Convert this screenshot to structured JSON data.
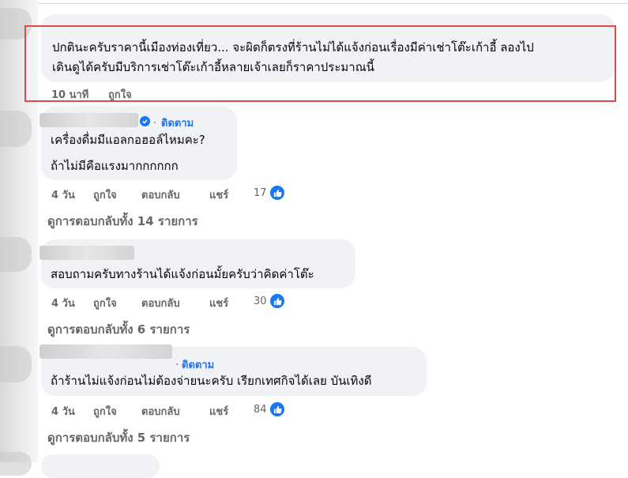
{
  "comment_highlighted": {
    "line1": "ปกตินะครับราคานี้เมืองท่องเที่ยว... จะผิดก็ตรงที่ร้านไม่ได้แจ้งก่อนเรื่องมีค่าเช่าโต๊ะเก้าอี้ ลองไป",
    "line2": "เดินดูได้ครับมีบริการเช่าโต๊ะเก้าอี้หลายเจ้าเลยก็ราคาประมาณนี้",
    "time": "10 นาที",
    "like": "ถูกใจ"
  },
  "comment1": {
    "dot": "·",
    "follow": "ติดตาม",
    "line1": "เครื่องดื่มมีแอลกอฮอล์ไหมคะ?",
    "line2": "ถ้าไม่มีคือแรงมากกกกกก",
    "time": "4 วัน",
    "like": "ถูกใจ",
    "reply": "ตอบกลับ",
    "share": "แชร์",
    "likes": "17",
    "view_replies": "ดูการตอบกลับทั้ง 14 รายการ"
  },
  "comment2": {
    "line1": "สอบถามครับทางร้านได้แจ้งก่อนมั้ยครับว่าคิดค่าโต๊ะ",
    "time": "4 วัน",
    "like": "ถูกใจ",
    "reply": "ตอบกลับ",
    "share": "แชร์",
    "likes": "30",
    "view_replies": "ดูการตอบกลับทั้ง 6 รายการ"
  },
  "comment3": {
    "dot": "·",
    "follow": "ติดตาม",
    "line1": "ถ้าร้านไม่แจ้งก่อนไม่ต้องจ่ายนะครับ เรียกเทศกิจได้เลย บันเทิงดี",
    "time": "4 วัน",
    "like": "ถูกใจ",
    "reply": "ตอบกลับ",
    "share": "แชร์",
    "likes": "84",
    "view_replies": "ดูการตอบกลับทั้ง 5 รายการ"
  },
  "colors": {
    "accent": "#1877f2",
    "highlight": "#e0484a",
    "bubble": "#f0f2f5",
    "meta": "#65676b"
  },
  "icons": {
    "like": "thumbs-up-icon",
    "verified": "verified-badge-icon"
  }
}
